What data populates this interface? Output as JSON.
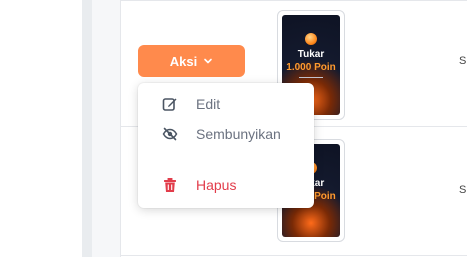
{
  "actions": {
    "button_label": "Aksi",
    "menu": [
      {
        "label": "Edit",
        "icon": "edit-icon"
      },
      {
        "label": "Sembunyikan",
        "icon": "eye-off-icon"
      },
      {
        "label": "Hapus",
        "icon": "trash-icon",
        "color": "#e23d4b"
      }
    ]
  },
  "rows": [
    {
      "thumb_title": "Tukar",
      "thumb_points": "1.000 Poin",
      "right_text": "S"
    },
    {
      "thumb_title": "Tukar",
      "thumb_points": "1.000 Poin",
      "right_text": "S"
    }
  ],
  "colors": {
    "accent": "#ff8a4c",
    "danger": "#e23d4b"
  }
}
